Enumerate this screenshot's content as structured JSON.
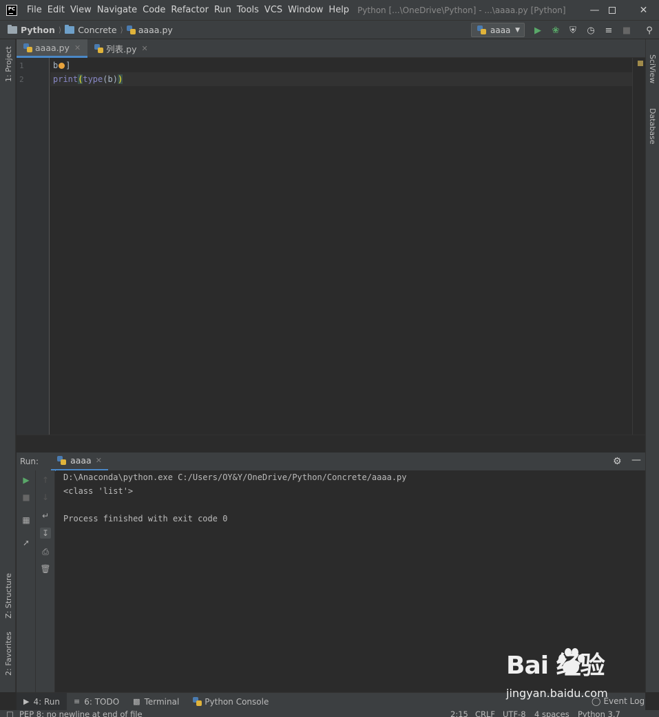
{
  "titlebar": {
    "logo_text": "PC",
    "menu": [
      "File",
      "Edit",
      "View",
      "Navigate",
      "Code",
      "Refactor",
      "Run",
      "Tools",
      "VCS",
      "Window",
      "Help"
    ],
    "window_title": "Python [...\\OneDrive\\Python] - ...\\aaaa.py [Python]"
  },
  "navbar": {
    "crumbs": [
      "Python",
      "Concrete",
      "aaaa.py"
    ],
    "run_config": "aaaa"
  },
  "left_strip": {
    "project": "1: Project",
    "structure": "Z: Structure",
    "favorites": "2: Favorites"
  },
  "right_strip": {
    "sciview": "SciView",
    "database": "Database"
  },
  "editor_tabs": [
    {
      "label": "aaaa.py",
      "active": true
    },
    {
      "label": "列表.py",
      "active": false
    }
  ],
  "editor": {
    "line_numbers": [
      "1",
      "2"
    ],
    "line1_a": "b",
    "line1_b": "]",
    "line2_kw1": "print",
    "line2_p1": "(",
    "line2_kw2": "type",
    "line2_mid": "(b)",
    "line2_p2": ")"
  },
  "run": {
    "label": "Run:",
    "tab": "aaaa",
    "console": [
      "D:\\Anaconda\\python.exe C:/Users/OY&Y/OneDrive/Python/Concrete/aaaa.py",
      "<class 'list'>",
      "",
      "Process finished with exit code 0"
    ]
  },
  "bottom_tabs": [
    {
      "label": "4: Run",
      "icon": "play-icon",
      "active": true
    },
    {
      "label": "6: TODO",
      "icon": "list-icon",
      "active": false
    },
    {
      "label": "Terminal",
      "icon": "terminal-icon",
      "active": false
    },
    {
      "label": "Python Console",
      "icon": "python-icon",
      "active": false
    }
  ],
  "event_log": "Event Log",
  "statusbar": {
    "message": "PEP 8: no newline at end of file",
    "position": "2:15",
    "line_sep": "CRLF",
    "encoding": "UTF-8",
    "indent": "4 spaces",
    "interpreter": "Python 3.7"
  },
  "watermark": {
    "logo": "Bai  经验",
    "url": "jingyan.baidu.com"
  },
  "colors": {
    "accent": "#4a88c7",
    "run_green": "#59a869",
    "bg": "#2b2b2b",
    "panel": "#3c3f41"
  }
}
